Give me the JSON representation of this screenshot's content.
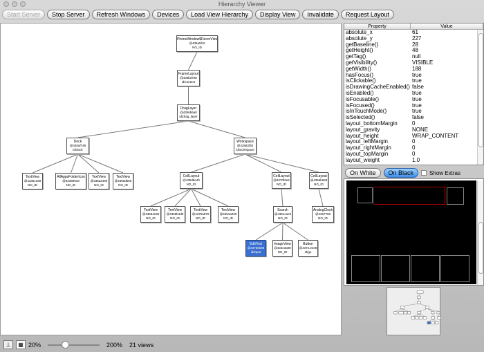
{
  "window": {
    "title": "Hierarchy Viewer"
  },
  "toolbar": [
    {
      "label": "Start Server",
      "disabled": true
    },
    {
      "label": "Stop Server"
    },
    {
      "label": "Refresh Windows"
    },
    {
      "label": "Devices"
    },
    {
      "label": "Load View Hierarchy"
    },
    {
      "label": "Display View"
    },
    {
      "label": "Invalidate"
    },
    {
      "label": "Request Layout"
    }
  ],
  "tree": [
    {
      "name": "PhoneWindow$DecorView",
      "hash": "@435a5fc0",
      "id": "NO_ID",
      "parent": -1
    },
    {
      "name": "FrameLayout",
      "hash": "@436bd798",
      "id": "id/content",
      "parent": 0
    },
    {
      "name": "DragLayer",
      "hash": "@43b6b6a0",
      "id": "id/drag_layer",
      "parent": 1
    },
    {
      "name": "Dock",
      "hash": "@435af748",
      "id": "id/dock",
      "parent": 2
    },
    {
      "name": "Workspace",
      "hash": "@43583f30",
      "id": "id/workspace",
      "parent": 2
    },
    {
      "name": "TextView",
      "hash": "@4336c168",
      "id": "NO_ID",
      "parent": 3
    },
    {
      "name": "AllAppsFolderIcon",
      "hash": "@43399918",
      "id": "NO_ID",
      "parent": 3
    },
    {
      "name": "TextView",
      "hash": "@435a2490",
      "id": "NO_ID",
      "parent": 3
    },
    {
      "name": "TextView",
      "hash": "@4356db50",
      "id": "NO_ID",
      "parent": 3
    },
    {
      "name": "CellLayout",
      "hash": "@435d9e40",
      "id": "NO_ID",
      "parent": 4
    },
    {
      "name": "CellLayout",
      "hash": "@4370f2e8",
      "id": "NO_ID",
      "parent": 4
    },
    {
      "name": "CellLayout",
      "hash": "@4356b628",
      "id": "NO_ID",
      "parent": 4
    },
    {
      "name": "TextView",
      "hash": "@43584e90",
      "id": "NO_ID",
      "parent": 9
    },
    {
      "name": "TextView",
      "hash": "@4368b4d0",
      "id": "NO_ID",
      "parent": 9
    },
    {
      "name": "TextView",
      "hash": "@4376a870",
      "id": "NO_ID",
      "parent": 9
    },
    {
      "name": "TextView",
      "hash": "@4351a030",
      "id": "NO_ID",
      "parent": 9
    },
    {
      "name": "Search",
      "hash": "@4351cae0",
      "id": "NO_ID",
      "parent": 10
    },
    {
      "name": "AnalogClock",
      "hash": "@4367768",
      "id": "NO_ID",
      "parent": 11
    },
    {
      "name": "EditText",
      "hash": "@43765698",
      "id": "id/input",
      "parent": 16,
      "selected": true
    },
    {
      "name": "ImageView",
      "hash": "@434e3a08",
      "id": "NO_ID",
      "parent": 16
    },
    {
      "name": "Button",
      "hash": "@4372.2ee8",
      "id": "id/go",
      "parent": 16
    }
  ],
  "properties": {
    "headers": [
      "Property",
      "Value"
    ],
    "rows": [
      [
        "absolute_x",
        "61"
      ],
      [
        "absolute_y",
        "227"
      ],
      [
        "getBaseline()",
        "28"
      ],
      [
        "getHeight()",
        "48"
      ],
      [
        "getTag()",
        "null"
      ],
      [
        "getVisibility()",
        "VISIBLE"
      ],
      [
        "getWidth()",
        "188"
      ],
      [
        "hasFocus()",
        "true"
      ],
      [
        "isClickable()",
        "true"
      ],
      [
        "isDrawingCacheEnabled()",
        "false"
      ],
      [
        "isEnabled()",
        "true"
      ],
      [
        "isFocusable()",
        "true"
      ],
      [
        "isFocused()",
        "true"
      ],
      [
        "isInTouchMode()",
        "true"
      ],
      [
        "isSelected()",
        "false"
      ],
      [
        "layout_bottomMargin",
        "0"
      ],
      [
        "layout_gravity",
        "NONE"
      ],
      [
        "layout_height",
        "WRAP_CONTENT"
      ],
      [
        "layout_leftMargin",
        "0"
      ],
      [
        "layout_rightMargin",
        "0"
      ],
      [
        "layout_topMargin",
        "0"
      ],
      [
        "layout_weight",
        "1.0"
      ]
    ]
  },
  "preview": {
    "on_white": "On White",
    "on_black": "On Black",
    "selected": "On Black",
    "show_extras": "Show Extras",
    "show_extras_checked": false
  },
  "status": {
    "zoom_min": "20%",
    "zoom_max": "200%",
    "views": "21 views",
    "zoom_value_percent": 50
  },
  "colors": {
    "selected_node": "#3a6fcf",
    "highlight": "#cc0000"
  }
}
